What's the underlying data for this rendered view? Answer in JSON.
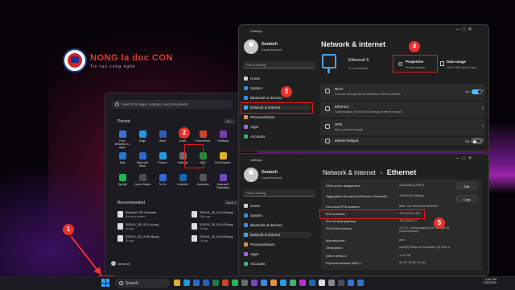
{
  "logo": {
    "title": "NONG la doc CON",
    "subtitle": "Tin tuc cong nghe"
  },
  "start_menu": {
    "search_placeholder": "Search for apps, settings, and documents",
    "pinned_title": "Pinned",
    "pinned_link": "All >",
    "pinned": [
      {
        "label": "Four Windows 11 Apps",
        "color": "#3b6fd8"
      },
      {
        "label": "Edge",
        "color": "#1a9be0"
      },
      {
        "label": "Word",
        "color": "#2b5eb8"
      },
      {
        "label": "Excel",
        "color": "#1f7a44"
      },
      {
        "label": "PowerPoint",
        "color": "#c8472a"
      },
      {
        "label": "OneNote",
        "color": "#7a3aa8"
      },
      {
        "label": "Mail",
        "color": "#2a78d0"
      },
      {
        "label": "Microsoft Store",
        "color": "#2a6ad0"
      },
      {
        "label": "Photos",
        "color": "#2a9ae0"
      },
      {
        "label": "Settings",
        "color": "#6a6a70"
      },
      {
        "label": "Xbox",
        "color": "#2a8a3a"
      },
      {
        "label": "File Explorer",
        "color": "#e0b030"
      },
      {
        "label": "Spotify",
        "color": "#1db954"
      },
      {
        "label": "Camo Studio",
        "color": "#4a4a55"
      },
      {
        "label": "To Do",
        "color": "#2a6ad0"
      },
      {
        "label": "LinkedIn",
        "color": "#1a66b0"
      },
      {
        "label": "Calculator",
        "color": "#555"
      },
      {
        "label": "Microsoft Clipchamp",
        "color": "#7a44c8"
      }
    ],
    "recommended_title": "Recommended",
    "recommended_link": "More >",
    "recommended": [
      {
        "title": "StarWind V2V Converter",
        "sub": "Recently added"
      },
      {
        "title": "2025-01_28_15-24-55.png",
        "sub": "28m ago"
      },
      {
        "title": "2025-01_28_15-11-46.png",
        "sub": "2h ago"
      },
      {
        "title": "2025-01_28_15-14-55.png",
        "sub": "3h ago"
      },
      {
        "title": "2025-01_28_14-56-28.png",
        "sub": "3h ago"
      },
      {
        "title": "2025-01_28_15-24-55.png",
        "sub": "4h ago"
      }
    ],
    "user": "Gentech"
  },
  "settings_back": {
    "window_title": "Settings",
    "user_name": "Gentech",
    "user_account": "Local Account",
    "find_placeholder": "Find a setting",
    "nav": [
      {
        "label": "Home",
        "color": "#cfcfcf"
      },
      {
        "label": "System",
        "color": "#3a8ae0"
      },
      {
        "label": "Bluetooth & devices",
        "color": "#3a8ae0"
      },
      {
        "label": "Network & internet",
        "color": "#4aa0e8"
      },
      {
        "label": "Personalization",
        "color": "#e0904a"
      },
      {
        "label": "Apps",
        "color": "#9a6ad8"
      },
      {
        "label": "Accounts",
        "color": "#3ab07a"
      }
    ],
    "heading": "Network & internet",
    "ethernet_name": "Ethernet 5",
    "ethernet_status": "Connected",
    "properties_title": "Properties",
    "properties_sub": "Private network",
    "data_usage_title": "Data usage",
    "data_usage_sub": "296.13 GB, last 30 days",
    "rows": [
      {
        "title": "Wi-Fi",
        "sub": "Connect, manage known networks, metered network",
        "toggle": "On",
        "toggle_on": true
      },
      {
        "title": "Ethernet",
        "sub": "Authentication, IP and DNS settings, metered network"
      },
      {
        "title": "VPN",
        "sub": "Add, connect, manage"
      },
      {
        "title": "Mobile hotspot",
        "sub": "",
        "toggle": "Off",
        "toggle_on": false
      }
    ]
  },
  "settings_front": {
    "window_title": "Settings",
    "user_name": "Gentech",
    "user_account": "Local Account",
    "find_placeholder": "Find a setting",
    "nav": [
      {
        "label": "Home",
        "color": "#cfcfcf"
      },
      {
        "label": "System",
        "color": "#3a8ae0"
      },
      {
        "label": "Bluetooth & devices",
        "color": "#3a8ae0"
      },
      {
        "label": "Network & internet",
        "color": "#4aa0e8"
      },
      {
        "label": "Personalization",
        "color": "#e0904a"
      },
      {
        "label": "Apps",
        "color": "#9a6ad8"
      },
      {
        "label": "Accounts",
        "color": "#3ab07a"
      }
    ],
    "breadcrumb_parent": "Network & internet",
    "breadcrumb_sep": ">",
    "breadcrumb_current": "Ethernet",
    "edit_label": "Edit",
    "copy_label": "Copy",
    "properties": [
      {
        "k": "DNS server assignment:",
        "v": "Automatic (DHCP)"
      },
      {
        "k": "Aggregated link speed (Receive/ Transmit):",
        "v": "1000/1000 (Mbps)"
      },
      {
        "k": "Link-local IPv6 address:",
        "v": "fe80::3c7:f9c6:af53:d5f4%19"
      },
      {
        "k": "IPv4 address:",
        "v": "192.168.22.101"
      },
      {
        "k": "IPv4 default gateway:",
        "v": "192.168.22.1"
      },
      {
        "k": "IPv4 DNS servers:",
        "v": "1.0.0.1 (Unencrypted) 192.168.58.26 (Unencrypted)"
      },
      {
        "k": "Manufacturer:",
        "v": "Intel"
      },
      {
        "k": "Description:",
        "v": "Intel(R) Ethernet Controller (3) I225-V"
      },
      {
        "k": "Driver version:",
        "v": "1.1.4.38"
      },
      {
        "k": "Physical address (MAC):",
        "v": "90-2F-74-DF-11-1E"
      }
    ]
  },
  "taskbar": {
    "search_label": "Search",
    "time": "3:46 PM",
    "date": "1/28/2025",
    "icons": [
      "#e0b030",
      "#1a9be0",
      "#2a6ad0",
      "#2b5eb8",
      "#1f7a44",
      "#c8472a",
      "#1db954",
      "#6a6a70",
      "#7a44c8",
      "#3a8ae0",
      "#e0904a",
      "#2a9ae0",
      "#3ab07a",
      "#c02fd0",
      "#1a66b0",
      "#ddd",
      "#888",
      "#4a4a55",
      "#3b6fd8",
      "#2a78d0"
    ]
  },
  "badges": [
    "1",
    "2",
    "3",
    "4",
    "5"
  ]
}
